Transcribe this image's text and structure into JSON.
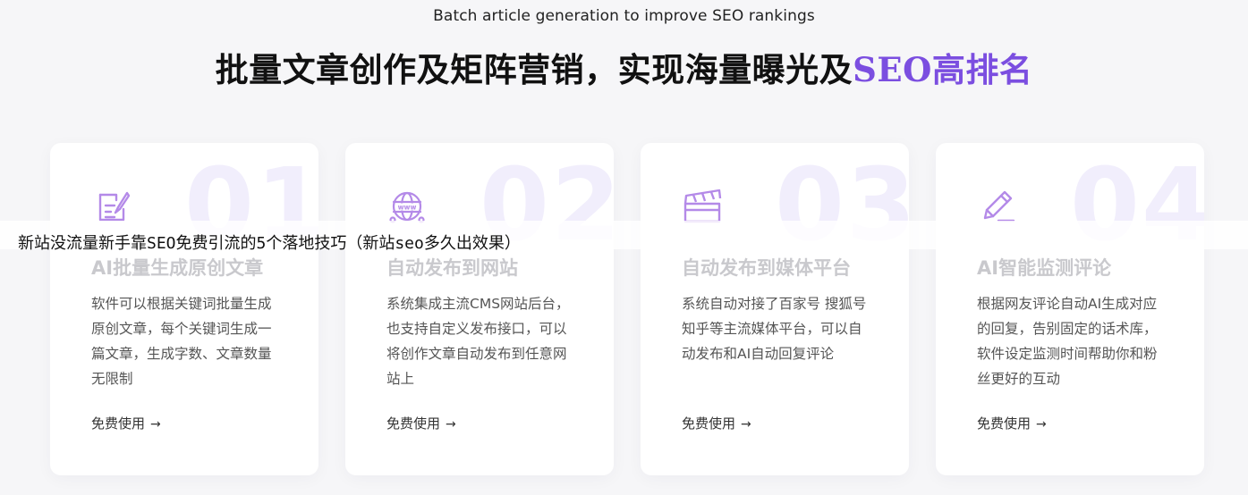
{
  "header": {
    "subtitle": "Batch article generation to improve SEO rankings",
    "headline_main": "批量文章创作及矩阵营销，实现海量曝光及",
    "headline_accent_seo": "SEO",
    "headline_accent_rest": "高排名"
  },
  "cards": [
    {
      "number": "01",
      "icon": "edit-document-icon",
      "title": "AI批量生成原创文章",
      "desc": "软件可以根据关键词批量生成原创文章，每个关键词生成一篇文章，生成字数、文章数量无限制",
      "link": "免费使用"
    },
    {
      "number": "02",
      "icon": "www-globe-icon",
      "title": "自动发布到网站",
      "desc": "系统集成主流CMS网站后台，也支持自定义发布接口，可以将创作文章自动发布到任意网站上",
      "link": "免费使用"
    },
    {
      "number": "03",
      "icon": "clapperboard-icon",
      "title": "自动发布到媒体平台",
      "desc": "系统自动对接了百家号 搜狐号 知乎等主流媒体平台，可以自动发布和AI自动回复评论",
      "link": "免费使用"
    },
    {
      "number": "04",
      "icon": "pencil-icon",
      "title": "AI智能监测评论",
      "desc": "根据网友评论自动AI生成对应的回复，告别固定的话术库，软件设定监测时间帮助你和粉丝更好的互动",
      "link": "免费使用"
    }
  ],
  "overlay": {
    "text": "新站没流量新手靠SEO免费引流的5个落地技巧（新站seo多久出效果）"
  },
  "colors": {
    "accent": "#7b4ee0",
    "icon": "#b48ae8",
    "watermark_number": "#f1eefc"
  }
}
